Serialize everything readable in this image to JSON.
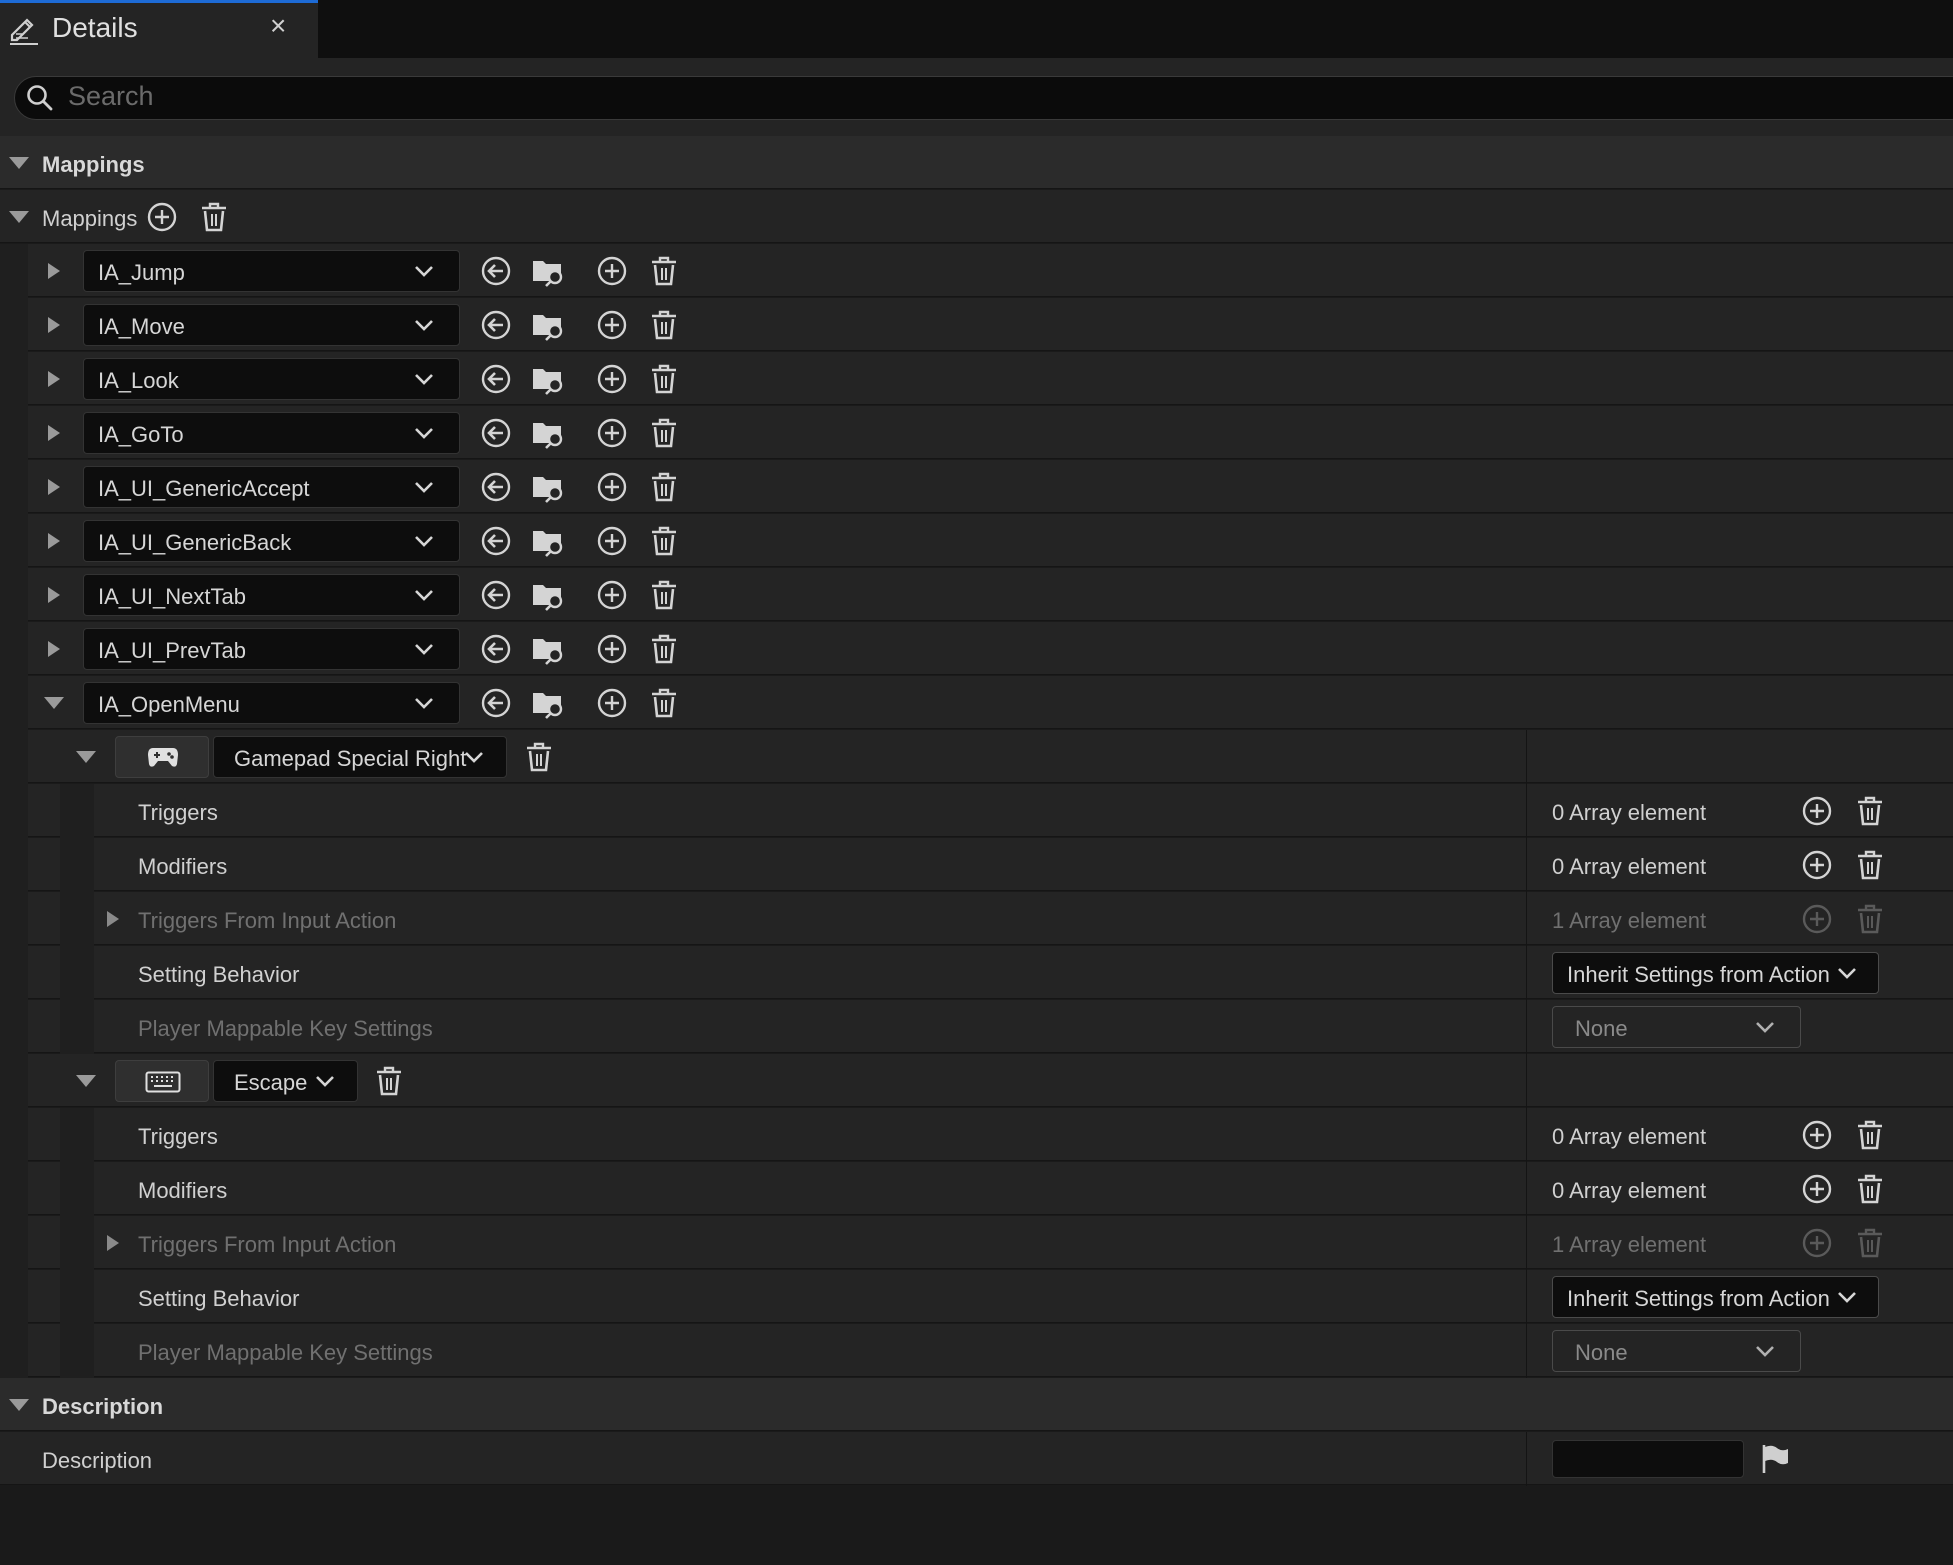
{
  "tab": {
    "title": "Details",
    "close": "×"
  },
  "search": {
    "placeholder": "Search"
  },
  "section_mappings": {
    "title": "Mappings"
  },
  "mappings_row": {
    "label": "Mappings"
  },
  "actions": [
    {
      "name": "IA_Jump",
      "expanded": false
    },
    {
      "name": "IA_Move",
      "expanded": false
    },
    {
      "name": "IA_Look",
      "expanded": false
    },
    {
      "name": "IA_GoTo",
      "expanded": false
    },
    {
      "name": "IA_UI_GenericAccept",
      "expanded": false
    },
    {
      "name": "IA_UI_GenericBack",
      "expanded": false
    },
    {
      "name": "IA_UI_NextTab",
      "expanded": false
    },
    {
      "name": "IA_UI_PrevTab",
      "expanded": false
    },
    {
      "name": "IA_OpenMenu",
      "expanded": true
    }
  ],
  "keys": [
    {
      "device_icon": "gamepad-icon",
      "key": "Gamepad Special Right",
      "props": [
        {
          "label": "Triggers",
          "value": "0 Array element",
          "enabled": true
        },
        {
          "label": "Modifiers",
          "value": "0 Array element",
          "enabled": true
        },
        {
          "label": "Triggers From Input Action",
          "value": "1 Array element",
          "enabled": false
        },
        {
          "label": "Setting Behavior",
          "value": "Inherit Settings from Action",
          "enabled": true
        },
        {
          "label": "Player Mappable Key Settings",
          "value": "None",
          "enabled": false
        }
      ]
    },
    {
      "device_icon": "keyboard-icon",
      "key": "Escape",
      "props": [
        {
          "label": "Triggers",
          "value": "0 Array element",
          "enabled": true
        },
        {
          "label": "Modifiers",
          "value": "0 Array element",
          "enabled": true
        },
        {
          "label": "Triggers From Input Action",
          "value": "1 Array element",
          "enabled": false
        },
        {
          "label": "Setting Behavior",
          "value": "Inherit Settings from Action",
          "enabled": true
        },
        {
          "label": "Player Mappable Key Settings",
          "value": "None",
          "enabled": false
        }
      ]
    }
  ],
  "section_description": {
    "title": "Description"
  },
  "description_row": {
    "label": "Description",
    "value": ""
  },
  "colors": {
    "background": "#1a1a1a",
    "panel": "#242424",
    "category": "#2b2b2b",
    "input": "#0d0d0d",
    "accent": "#1d6bd6",
    "text": "#d0d0d0",
    "disabled_text": "#707070"
  }
}
